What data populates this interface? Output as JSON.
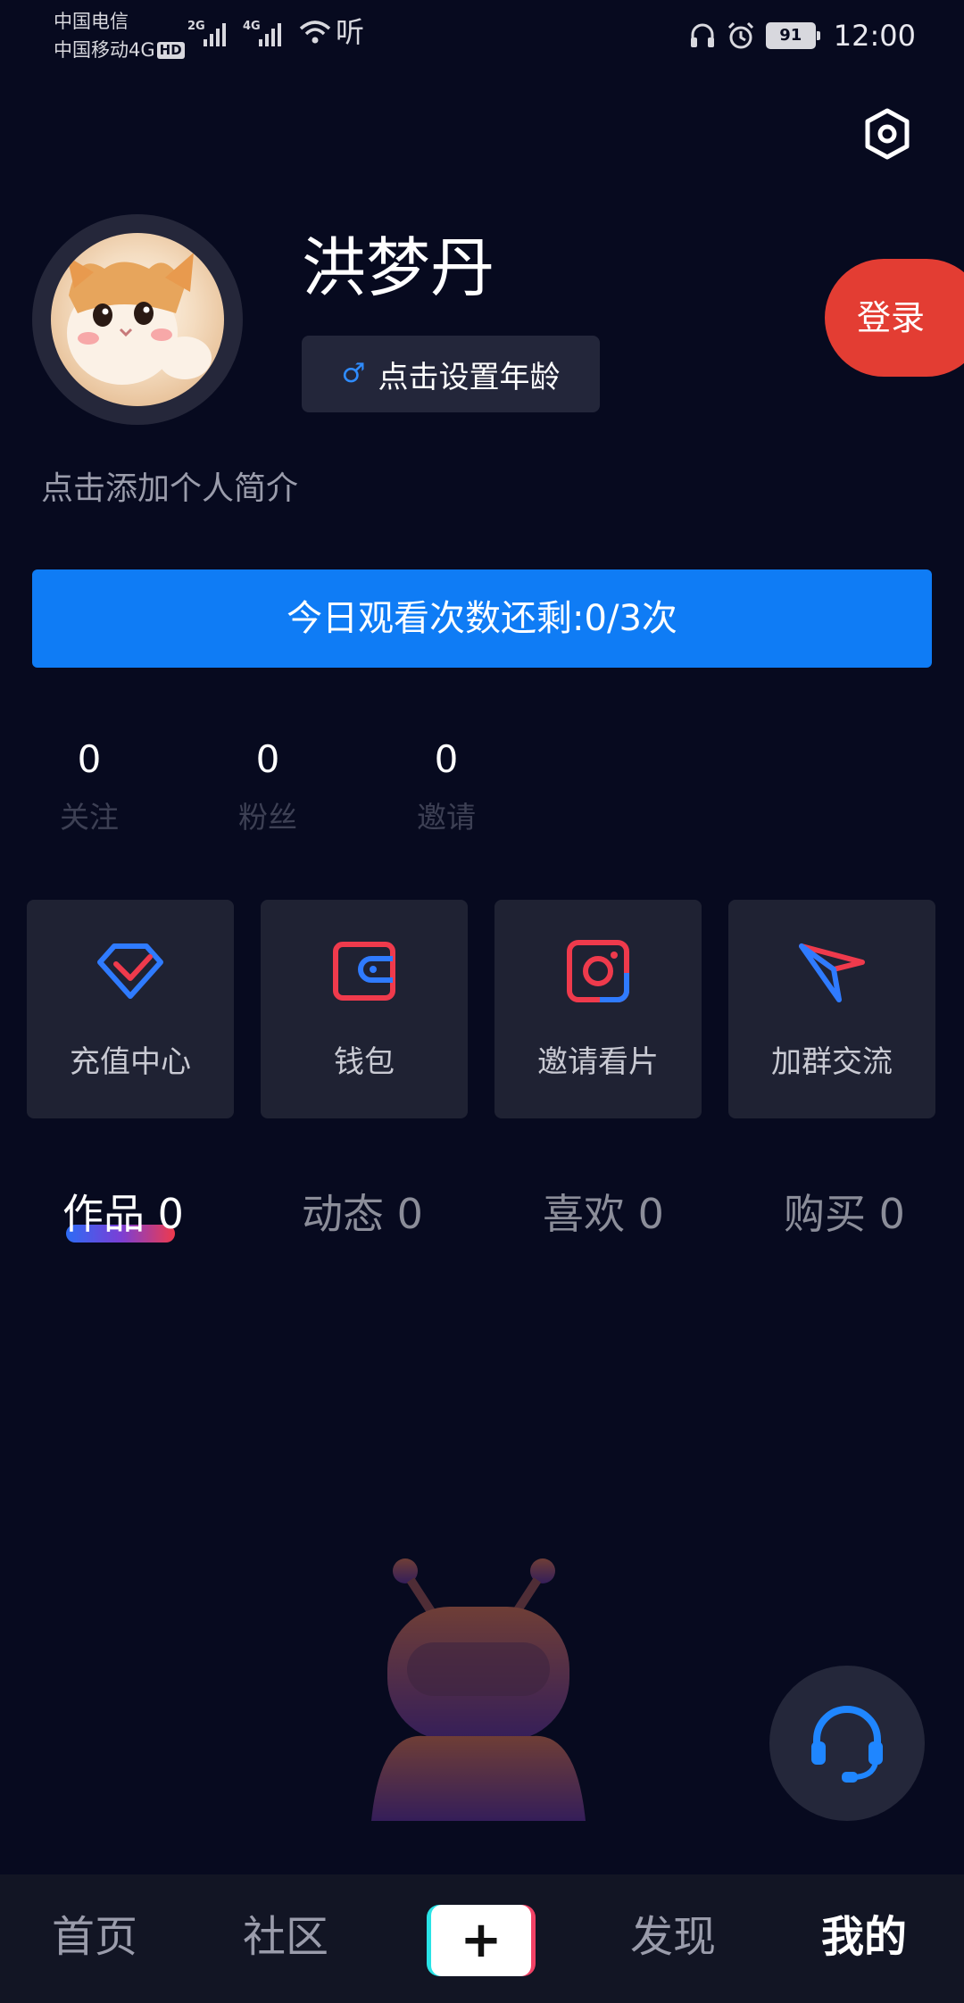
{
  "status_bar": {
    "carrier_1": "中国电信",
    "carrier_2": "中国移动4G",
    "hd_badge": "HD",
    "signal_1_gen": "2G",
    "signal_2_gen": "4G",
    "listen_glyph": "听",
    "battery": "91",
    "time": "12:00"
  },
  "profile": {
    "username": "洪梦丹",
    "age_button": "点击设置年龄",
    "gender_symbol": "♂",
    "login_button": "登录",
    "bio_placeholder": "点击添加个人简介"
  },
  "watch_banner": "今日观看次数还剩:0/3次",
  "stats": [
    {
      "value": "0",
      "label": "关注"
    },
    {
      "value": "0",
      "label": "粉丝"
    },
    {
      "value": "0",
      "label": "邀请"
    }
  ],
  "features": [
    {
      "label": "充值中心",
      "icon": "diamond-icon"
    },
    {
      "label": "钱包",
      "icon": "wallet-icon"
    },
    {
      "label": "邀请看片",
      "icon": "camera-icon"
    },
    {
      "label": "加群交流",
      "icon": "paper-plane-icon"
    }
  ],
  "tabs": [
    {
      "label": "作品 0",
      "active": true
    },
    {
      "label": "动态 0",
      "active": false
    },
    {
      "label": "喜欢 0",
      "active": false
    },
    {
      "label": "购买 0",
      "active": false
    }
  ],
  "bottom_nav": [
    {
      "label": "首页",
      "active": false
    },
    {
      "label": "社区",
      "active": false
    },
    {
      "label": "+",
      "active": false
    },
    {
      "label": "发现",
      "active": false
    },
    {
      "label": "我的",
      "active": true
    }
  ],
  "colors": {
    "background": "#070a1f",
    "accent_blue": "#0f7cf5",
    "login_red": "#e33d33",
    "card_bg": "#1f2233"
  }
}
